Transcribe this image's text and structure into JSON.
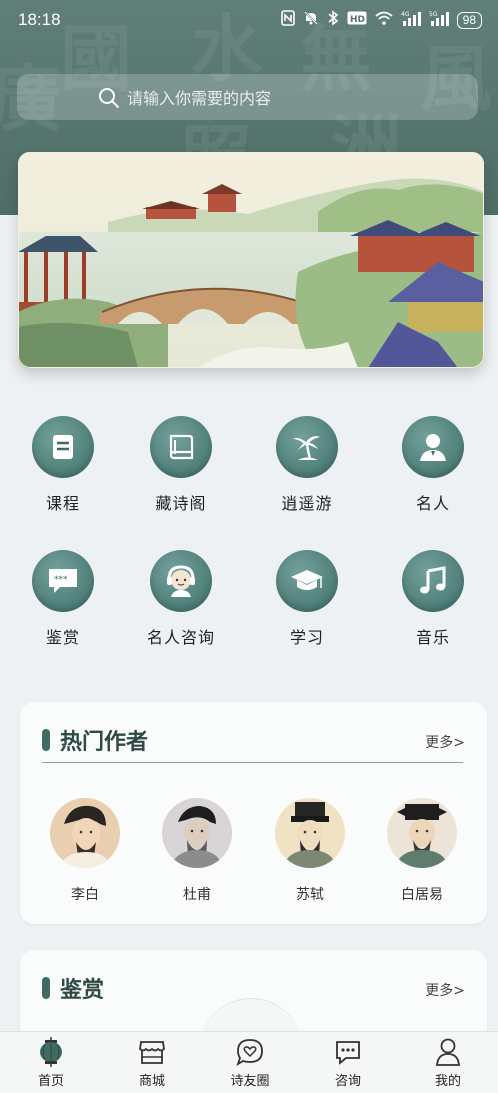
{
  "status_bar": {
    "time": "18:18",
    "icons": [
      "nfc-icon",
      "mute-icon",
      "bluetooth-icon",
      "hd-icon",
      "wifi-icon",
      "signal-4g-icon",
      "signal-5g-icon"
    ],
    "battery": "98"
  },
  "search": {
    "placeholder": "请输入你需要的内容"
  },
  "categories": [
    {
      "label": "课程",
      "icon": "document-icon"
    },
    {
      "label": "藏诗阁",
      "icon": "book-icon"
    },
    {
      "label": "逍遥游",
      "icon": "palm-tree-icon"
    },
    {
      "label": "名人",
      "icon": "person-icon"
    },
    {
      "label": "鉴赏",
      "icon": "rating-bubble-icon"
    },
    {
      "label": "名人咨询",
      "icon": "headset-avatar-icon"
    },
    {
      "label": "学习",
      "icon": "graduation-cap-icon"
    },
    {
      "label": "音乐",
      "icon": "music-note-icon"
    }
  ],
  "hot_authors": {
    "title": "热门作者",
    "more": "更多>",
    "authors": [
      {
        "name": "李白"
      },
      {
        "name": "杜甫"
      },
      {
        "name": "苏轼"
      },
      {
        "name": "白居易"
      }
    ]
  },
  "appreciation": {
    "title": "鉴赏",
    "more": "更多>"
  },
  "bottom_nav": [
    {
      "label": "首页",
      "icon": "lantern-icon"
    },
    {
      "label": "商城",
      "icon": "store-icon"
    },
    {
      "label": "诗友圈",
      "icon": "heart-bubble-icon"
    },
    {
      "label": "咨询",
      "icon": "chat-icon"
    },
    {
      "label": "我的",
      "icon": "user-icon"
    }
  ],
  "colors": {
    "header_bg": "#56756e",
    "accent": "#3f6b64",
    "page_bg": "#eef1f3"
  }
}
